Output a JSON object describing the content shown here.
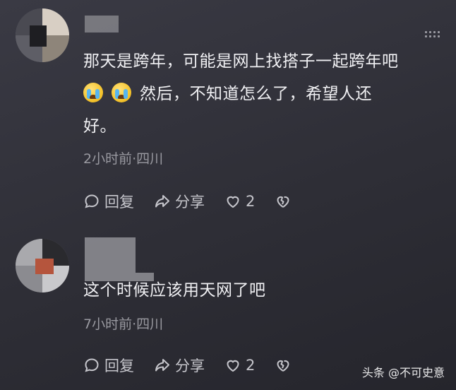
{
  "comments": [
    {
      "text_lines": [
        "那天是跨年，可能是网上找搭子一起跨年吧",
        "然后，不知道怎么了，希望人还",
        "好。"
      ],
      "emoji": [
        "crying-face-icon",
        "crying-face-icon"
      ],
      "meta": "2小时前·四川",
      "reply_label": "回复",
      "share_label": "分享",
      "like_count": "2"
    },
    {
      "text_lines": [
        "这个时候应该用天网了吧"
      ],
      "meta": "7小时前·四川",
      "reply_label": "回复",
      "share_label": "分享",
      "like_count": "2"
    }
  ],
  "watermark": "头条 @不可史意",
  "colors": {
    "background": "#2e2e36",
    "text": "#f0f0f3",
    "meta": "#9a9aa1",
    "actions": "#c6c6cc",
    "emoji": "#f5c530"
  }
}
